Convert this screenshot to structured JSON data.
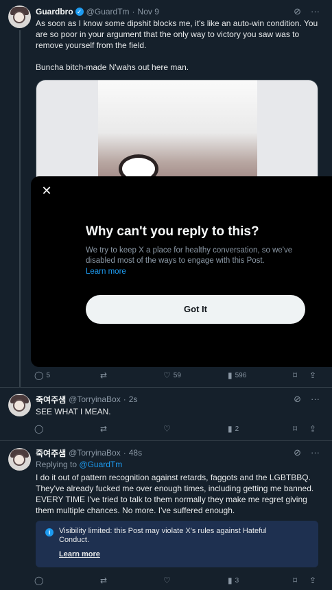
{
  "tweets": [
    {
      "name": "Guardbro",
      "handle": "@GuardTm",
      "time": "Nov 9",
      "text": [
        "As soon as I know some dipshit blocks me, it's like an auto-win condition. You are so poor in your argument that the only way to victory you saw was to remove yourself from the field.",
        "Buncha bitch-made N'wahs out here man."
      ],
      "replies": "5",
      "likes": "59",
      "views": "596"
    },
    {
      "name": "죽여주샘",
      "handle": "@TorryinaBox",
      "time": "2s",
      "text": "SEE WHAT I MEAN.",
      "views": "2"
    },
    {
      "name": "죽여주샘",
      "handle": "@TorryinaBox",
      "time": "48s",
      "replying_prefix": "Replying to",
      "replying_to": "@GuardTm",
      "text": "I do it out of pattern recognition against retards, faggots and the LGBTBBQ. They've already fucked me over enough times, including getting me banned. EVERY TIME I've tried to talk to them normally they make me regret giving them multiple chances. No more. I've suffered enough.",
      "visibility_notice": "Visibility limited: this Post may violate X's rules against Hateful Conduct.",
      "visibility_link": "Learn more",
      "views": "3"
    }
  ],
  "modal": {
    "title": "Why can't you reply to this?",
    "body": "We try to keep X a place for healthy conversation, so we've disabled most of the ways to engage with this Post.",
    "link": "Learn more",
    "button": "Got It"
  },
  "colors": {
    "background": "#15202b",
    "accent": "#1d9bf0",
    "muted": "#8b98a5",
    "modal": "#000000"
  }
}
